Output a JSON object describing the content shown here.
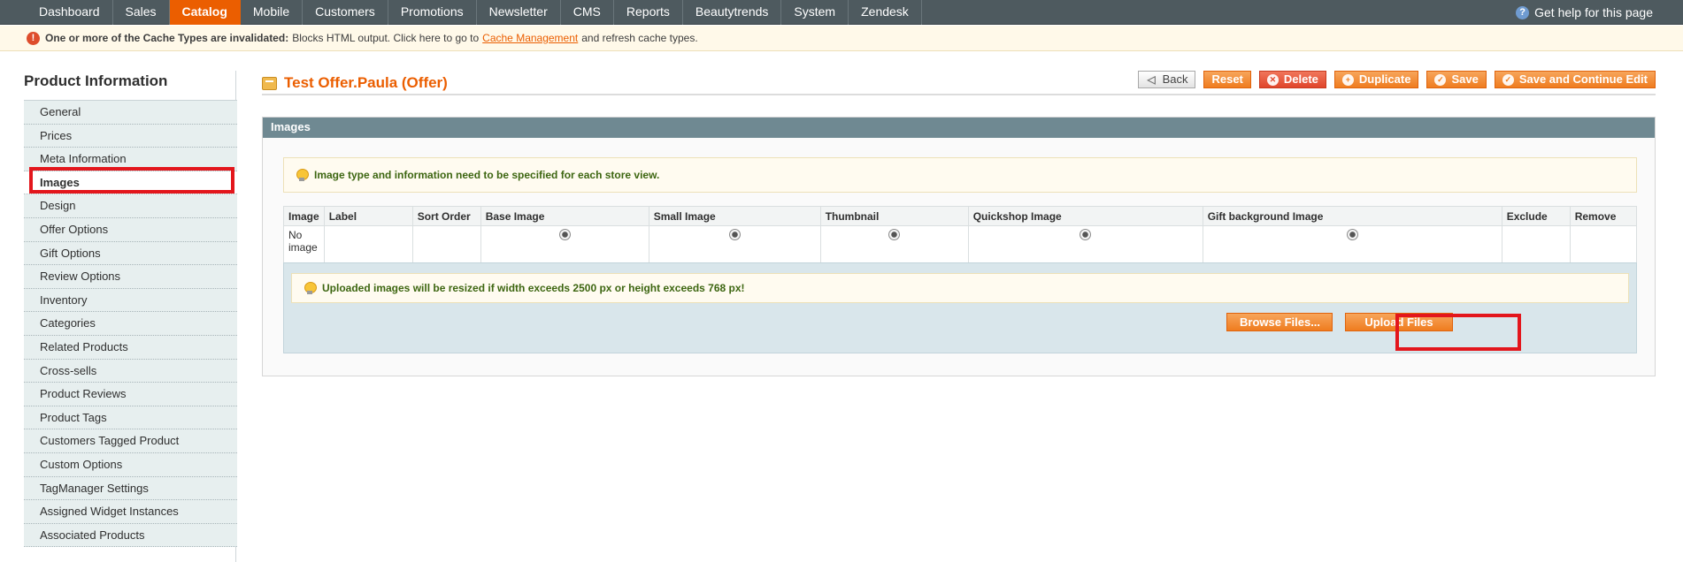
{
  "nav": {
    "items": [
      "Dashboard",
      "Sales",
      "Catalog",
      "Mobile",
      "Customers",
      "Promotions",
      "Newsletter",
      "CMS",
      "Reports",
      "Beautytrends",
      "System",
      "Zendesk"
    ],
    "active": "Catalog",
    "help": "Get help for this page"
  },
  "notice": {
    "bold": "One or more of the Cache Types are invalidated:",
    "text": "Blocks HTML output. Click here to go to",
    "link": "Cache Management",
    "suffix": "and refresh cache types."
  },
  "sidebar": {
    "title": "Product Information",
    "items": [
      "General",
      "Prices",
      "Meta Information",
      "Images",
      "Design",
      "Offer Options",
      "Gift Options",
      "Review Options",
      "Inventory",
      "Categories",
      "Related Products",
      "Cross-sells",
      "Product Reviews",
      "Product Tags",
      "Customers Tagged Product",
      "Custom Options",
      "TagManager Settings",
      "Assigned Widget Instances",
      "Associated Products"
    ],
    "active_index": 3
  },
  "header": {
    "title": "Test Offer.Paula (Offer)",
    "buttons": {
      "back": "Back",
      "reset": "Reset",
      "delete": "Delete",
      "duplicate": "Duplicate",
      "save": "Save",
      "save_continue": "Save and Continue Edit"
    }
  },
  "images": {
    "section_title": "Images",
    "notice": "Image type and information need to be specified for each store view.",
    "columns": [
      "Image",
      "Label",
      "Sort Order",
      "Base Image",
      "Small Image",
      "Thumbnail",
      "Quickshop Image",
      "Gift background Image",
      "Exclude",
      "Remove"
    ],
    "row": {
      "image": "No image"
    },
    "upload_notice": "Uploaded images will be resized if width exceeds 2500 px or height exceeds 768 px!",
    "browse": "Browse Files...",
    "upload": "Upload Files"
  },
  "colors": {
    "accent": "#eb5e00",
    "nav_bg": "#4e5a5f",
    "section_head": "#6f8992",
    "highlight": "#e3161c"
  }
}
